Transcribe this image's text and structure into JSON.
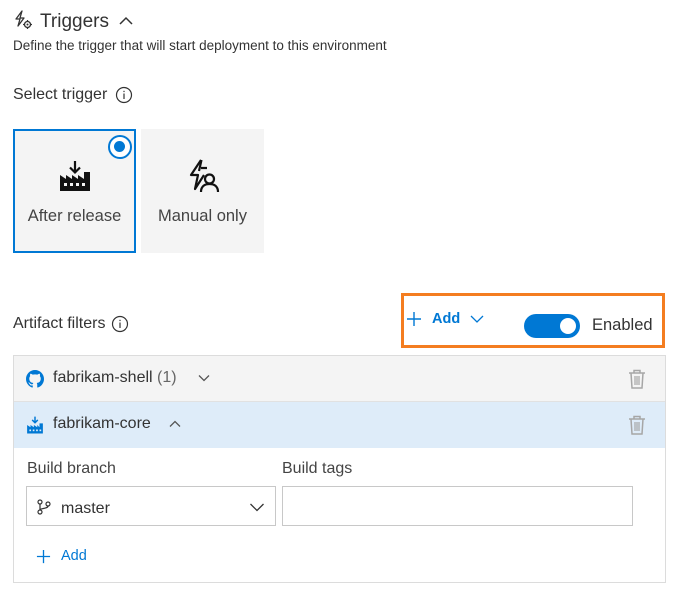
{
  "header": {
    "title": "Triggers",
    "description": "Define the trigger that will start deployment to this environment"
  },
  "select_trigger": {
    "label": "Select trigger",
    "options": [
      {
        "label": "After release",
        "selected": true
      },
      {
        "label": "Manual only",
        "selected": false
      }
    ]
  },
  "artifact_filters": {
    "label": "Artifact filters",
    "add_label": "Add",
    "toggle_label": "Enabled",
    "toggle_on": true,
    "items": [
      {
        "name": "fabrikam-shell",
        "count": "(1)",
        "expanded": false
      },
      {
        "name": "fabrikam-core",
        "expanded": true
      }
    ],
    "build_branch_label": "Build branch",
    "build_branch_value": "master",
    "build_tags_label": "Build tags",
    "build_tags_value": "",
    "add_filter_label": "Add"
  },
  "colors": {
    "accent": "#0078d4",
    "highlight": "#f47d20",
    "selected_row": "#deecf9",
    "card_bg": "#f4f4f4"
  }
}
